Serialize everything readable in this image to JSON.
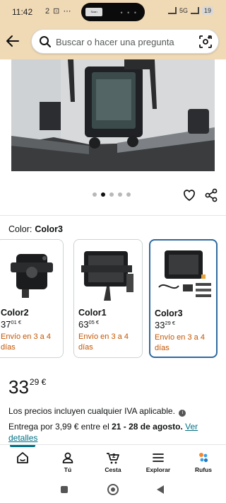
{
  "status_bar": {
    "time": "11:42",
    "glyphs": "2 ⊡ ⋯",
    "island_app": "Scan Selector",
    "network": "5G",
    "battery": "19"
  },
  "search": {
    "placeholder": "Buscar o hacer una pregunta"
  },
  "carousel": {
    "total": 5,
    "active_index": 1
  },
  "color_selector": {
    "label": "Color:",
    "selected": "Color3"
  },
  "variants": [
    {
      "name": "Color2",
      "price_whole": "37",
      "price_fraction": "01 €",
      "shipping": "Envío en 3 a 4 días",
      "selected": false
    },
    {
      "name": "Color1",
      "price_whole": "63",
      "price_fraction": "05 €",
      "shipping": "Envío en 3 a 4 días",
      "selected": false
    },
    {
      "name": "Color3",
      "price_whole": "33",
      "price_fraction": "29 €",
      "shipping": "Envío en 3 a 4 días",
      "selected": true
    }
  ],
  "price": {
    "whole": "33",
    "fraction": "29 €"
  },
  "tax_note": "Los precios incluyen cualquier IVA aplicable.",
  "delivery": {
    "prefix": "Entrega por 3,99 € entre el",
    "dates": "21 - 28 de agosto.",
    "link": "Ver detalles"
  },
  "bottom_nav": {
    "items": [
      {
        "label": "",
        "icon": "home-icon",
        "active": true
      },
      {
        "label": "Tú",
        "icon": "user-icon",
        "active": false
      },
      {
        "label": "Cesta",
        "icon": "cart-icon",
        "badge": "2",
        "active": false
      },
      {
        "label": "Explorar",
        "icon": "menu-icon",
        "active": false
      },
      {
        "label": "Rufus",
        "icon": "rufus-icon",
        "active": false
      }
    ]
  },
  "colors": {
    "header_bg": "#f0d9b5",
    "link": "#007185",
    "shipping": "#c45500",
    "selected_border": "#2e6a9e"
  }
}
